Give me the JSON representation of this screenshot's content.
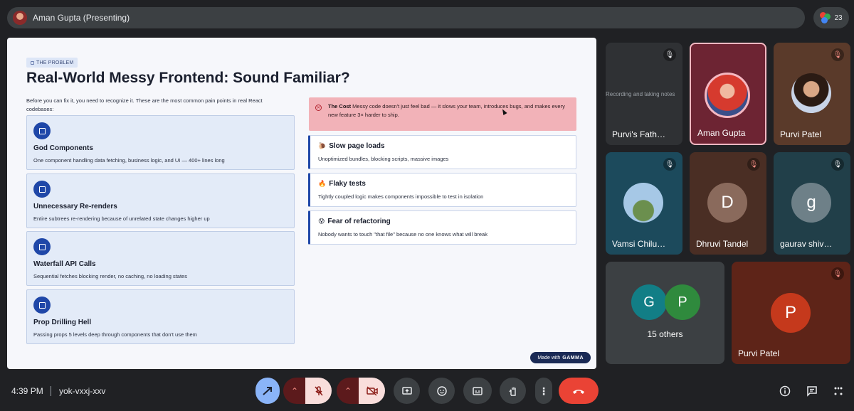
{
  "presenter": {
    "label": "Aman Gupta (Presenting)"
  },
  "participants": {
    "count": "23"
  },
  "slide": {
    "tag": "THE PROBLEM",
    "title": "Real-World Messy Frontend: Sound Familiar?",
    "intro": "Before you can fix it, you need to recognize it. These are the most common pain points in real React codebases:",
    "cards": [
      {
        "title": "God Components",
        "desc": "One component handling data fetching, business logic, and UI — 400+ lines long"
      },
      {
        "title": "Unnecessary Re-renders",
        "desc": "Entire subtrees re-rendering because of unrelated state changes higher up"
      },
      {
        "title": "Waterfall API Calls",
        "desc": "Sequential fetches blocking render, no caching, no loading states"
      },
      {
        "title": "Prop Drilling Hell",
        "desc": "Passing props 5 levels deep through components that don't use them"
      }
    ],
    "callout": {
      "strong": "The Cost",
      "text": " Messy code doesn't just feel bad — it slows your team, introduces bugs, and makes every new feature 3× harder to ship."
    },
    "pains": [
      {
        "emoji": "🐌",
        "title": "Slow page loads",
        "desc": "Unoptimized bundles, blocking scripts, massive images"
      },
      {
        "emoji": "🔥",
        "title": "Flaky tests",
        "desc": "Tightly coupled logic makes components impossible to test in isolation"
      },
      {
        "emoji": "😰",
        "title": "Fear of refactoring",
        "desc": "Nobody wants to touch \"that file\" because no one knows what will break"
      }
    ],
    "badge": {
      "prefix": "Made with",
      "brand": "GAMMA"
    }
  },
  "tiles": {
    "purvi_father": {
      "name": "Purvi's Fath…",
      "screen_text": "Recording and taking notes"
    },
    "aman": {
      "name": "Aman Gupta"
    },
    "purvi_patel": {
      "name": "Purvi Patel"
    },
    "vamsi": {
      "name": "Vamsi Chilu…"
    },
    "dhruvi": {
      "name": "Dhruvi Tandel",
      "initial": "D"
    },
    "gaurav": {
      "name": "gaurav shiv…",
      "initial": "g"
    },
    "others": {
      "initial1": "G",
      "initial2": "P",
      "label": "15 others"
    },
    "purvi_patel2": {
      "name": "Purvi Patel",
      "initial": "P"
    }
  },
  "bottom": {
    "time": "4:39 PM",
    "meeting_code": "yok-vxxj-xxv"
  },
  "colors": {
    "background": "#202124",
    "end_call": "#ea4335",
    "present_active": "#8ab4f8",
    "muted_red": "#f9dedc"
  }
}
